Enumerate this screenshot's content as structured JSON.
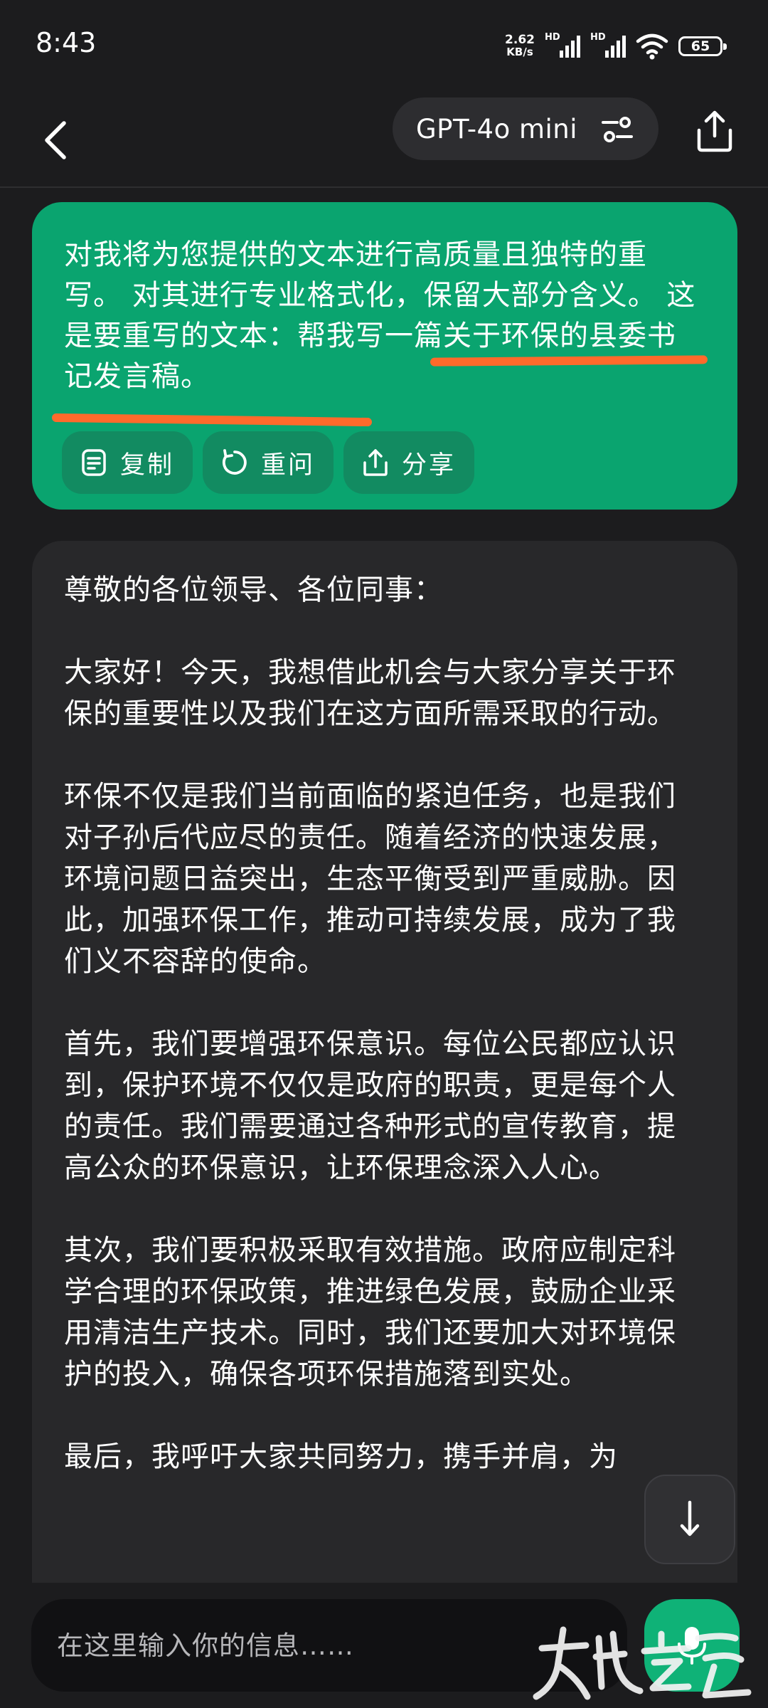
{
  "status_bar": {
    "time": "8:43",
    "net_speed_value": "2.62",
    "net_speed_unit": "KB/s",
    "sim1_label": "HD",
    "sim2_label": "HD",
    "battery": "65",
    "icons": [
      "signal-icon",
      "signal-icon",
      "wifi-icon",
      "battery-icon"
    ]
  },
  "header": {
    "model_name": "GPT-4o mini",
    "icons": [
      "back-arrow-icon",
      "tune-icon",
      "share-icon"
    ]
  },
  "user_message": {
    "text": "对我将为您提供的文本进行高质量且独特的重写。 对其进行专业格式化，保留大部分含义。 这是要重写的文本：帮我写一篇关于环保的县委书记发言稿。",
    "highlight_color": "#ff6a2b",
    "actions": [
      {
        "label": "复制",
        "icon": "copy-icon"
      },
      {
        "label": "重问",
        "icon": "refresh-icon"
      },
      {
        "label": "分享",
        "icon": "share-icon"
      }
    ]
  },
  "ai_message": {
    "paragraphs": [
      "尊敬的各位领导、各位同事：",
      "大家好！今天，我想借此机会与大家分享关于环保的重要性以及我们在这方面所需采取的行动。",
      "环保不仅是我们当前面临的紧迫任务，也是我们对子孙后代应尽的责任。随着经济的快速发展，环境问题日益突出，生态平衡受到严重威胁。因此，加强环保工作，推动可持续发展，成为了我们义不容辞的使命。",
      "首先，我们要增强环保意识。每位公民都应认识到，保护环境不仅仅是政府的职责，更是每个人的责任。我们需要通过各种形式的宣传教育，提高公众的环保意识，让环保理念深入人心。",
      "其次，我们要积极采取有效措施。政府应制定科学合理的环保政策，推进绿色发展，鼓励企业采用清洁生产技术。同时，我们还要加大对环境保护的投入，确保各项环保措施落到实处。",
      "最后，我呼吁大家共同努力，携手并肩，为"
    ]
  },
  "input": {
    "placeholder": "在这里输入你的信息……"
  },
  "colors": {
    "background": "#1c1c1e",
    "user_bubble": "#0aa46f",
    "ai_bubble": "#28282a",
    "accent": "#0fb277"
  }
}
